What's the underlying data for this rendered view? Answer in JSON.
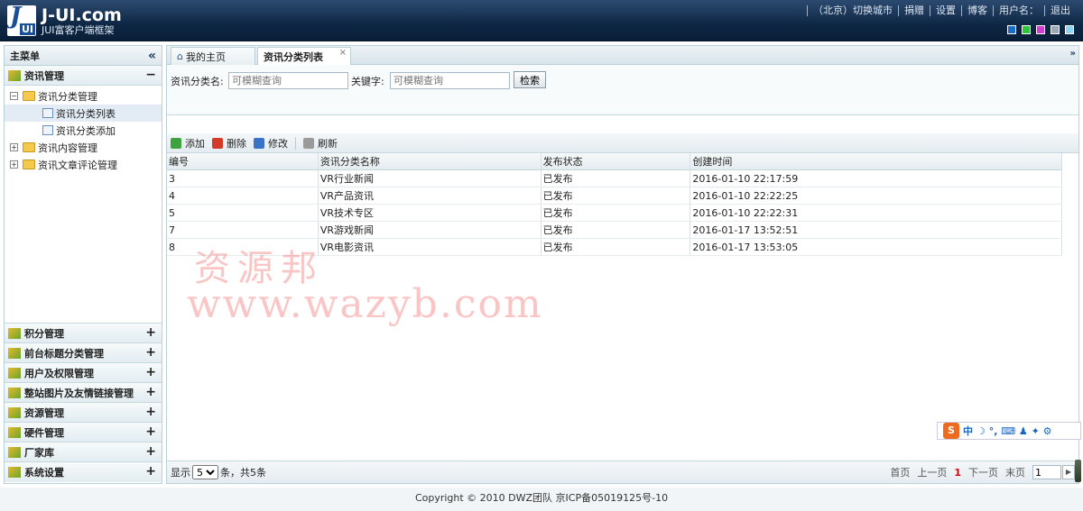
{
  "header": {
    "logo_title": "J-UI.com",
    "logo_subtitle": "JUI富客户端框架",
    "logo_mark_letter": "J",
    "logo_mark_ui": "UI",
    "nav": [
      "（北京）切换城市",
      "捐赠",
      "设置",
      "博客",
      "用户名：",
      "退出"
    ],
    "themes": [
      "#1b6cc9",
      "#2cc63a",
      "#d43bd1",
      "#9aa7b4",
      "#8fd3f0"
    ]
  },
  "sidebar": {
    "title": "主菜单",
    "collapse_icon": "«",
    "sections": [
      {
        "label": "资讯管理",
        "expanded": true,
        "toggle": "−"
      },
      {
        "label": "积分管理",
        "toggle": "+"
      },
      {
        "label": "前台标题分类管理",
        "toggle": "+"
      },
      {
        "label": "用户及权限管理",
        "toggle": "+"
      },
      {
        "label": "整站图片及友情链接管理",
        "toggle": "+"
      },
      {
        "label": "资源管理",
        "toggle": "+"
      },
      {
        "label": "硬件管理",
        "toggle": "+"
      },
      {
        "label": "厂家库",
        "toggle": "+"
      },
      {
        "label": "系统设置",
        "toggle": "+"
      }
    ],
    "tree": [
      {
        "label": "资讯分类管理",
        "toggle": "−"
      },
      {
        "label": "资讯分类列表",
        "selected": true
      },
      {
        "label": "资讯分类添加"
      },
      {
        "label": "资讯内容管理",
        "toggle": "+"
      },
      {
        "label": "资讯文章评论管理",
        "toggle": "+"
      }
    ]
  },
  "tabs": [
    {
      "label": "我的主页",
      "icon": "⌂"
    },
    {
      "label": "资讯分类列表",
      "close": "×"
    }
  ],
  "tabs_more": "»",
  "search": {
    "category_label": "资讯分类名:",
    "category_placeholder": "可模糊查询",
    "keyword_label": "关键字:",
    "keyword_placeholder": "可模糊查询",
    "button": "检索"
  },
  "toolbar": [
    {
      "label": "添加",
      "color": "#3ea33e"
    },
    {
      "label": "删除",
      "color": "#d23a2a"
    },
    {
      "label": "修改",
      "color": "#3a72c8"
    },
    {
      "label": "刷新",
      "color": "#9a9a9a"
    }
  ],
  "grid": {
    "columns": [
      "编号",
      "资讯分类名称",
      "发布状态",
      "创建时间"
    ],
    "rows": [
      [
        "3",
        "VR行业新闻",
        "已发布",
        "2016-01-10 22:17:59"
      ],
      [
        "4",
        "VR产品资讯",
        "已发布",
        "2016-01-10 22:22:25"
      ],
      [
        "5",
        "VR技术专区",
        "已发布",
        "2016-01-10 22:22:31"
      ],
      [
        "7",
        "VR游戏新闻",
        "已发布",
        "2016-01-17 13:52:51"
      ],
      [
        "8",
        "VR电影资讯",
        "已发布",
        "2016-01-17 13:53:05"
      ]
    ]
  },
  "pager": {
    "show_label": "显示",
    "page_size": "5",
    "summary": "条，共5条",
    "first": "首页",
    "prev": "上一页",
    "current": "1",
    "next": "下一页",
    "last": "末页",
    "goto_value": "1",
    "go_icon": "▶"
  },
  "watermark": {
    "line1": "资源邦",
    "line2": "www.wazyb.com"
  },
  "ime": {
    "brand": "S",
    "mode": "中",
    "icons": "☽ °, ⌨ ♟ ✦ ⚙"
  },
  "footer": "Copyright © 2010 DWZ团队 京ICP备05019125号-10"
}
